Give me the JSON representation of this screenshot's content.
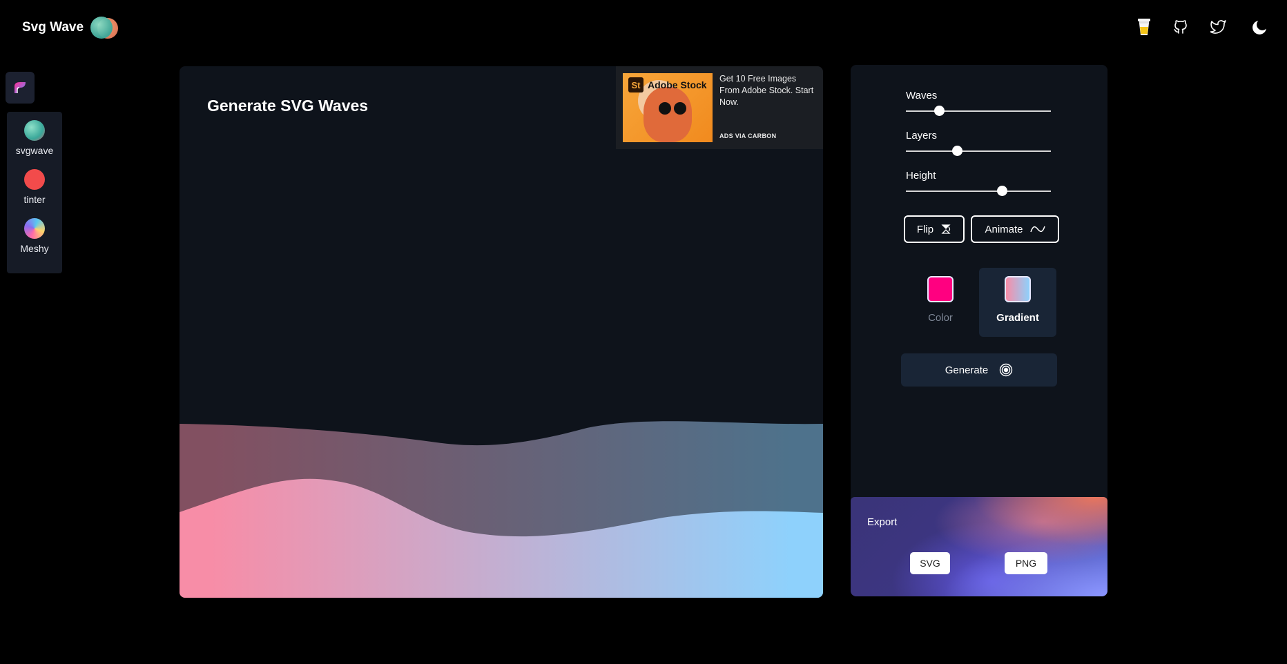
{
  "header": {
    "title": "Svg Wave",
    "icons": [
      "coffee-icon",
      "github-icon",
      "twitter-icon",
      "moon-icon"
    ]
  },
  "sidebar": {
    "apps": [
      {
        "label": "svgwave",
        "color": "#4cc9b0"
      },
      {
        "label": "tinter",
        "color": "#f24b4b"
      },
      {
        "label": "Meshy",
        "color": "#8a6cf0"
      }
    ]
  },
  "canvas": {
    "title": "Generate SVG Waves"
  },
  "ad": {
    "brand": "Adobe Stock",
    "badge": "St",
    "text": "Get 10 Free Images From Adobe Stock. Start Now.",
    "via": "ADS VIA CARBON"
  },
  "controls": {
    "sliders": [
      {
        "label": "Waves",
        "value": 0.23
      },
      {
        "label": "Layers",
        "value": 0.35
      },
      {
        "label": "Height",
        "value": 0.66
      }
    ],
    "flip_label": "Flip",
    "animate_label": "Animate",
    "color_label": "Color",
    "gradient_label": "Gradient",
    "color_value": "#ff0080",
    "gradient_colors": [
      "#f78da7",
      "#8ed1fc"
    ],
    "selected_mode": "Gradient",
    "generate_label": "Generate"
  },
  "export": {
    "title": "Export",
    "svg_label": "SVG",
    "png_label": "PNG"
  },
  "colors": {
    "background": "#000000",
    "panel": "#0e131b",
    "wave_start": "#f78da7",
    "wave_end": "#8ed1fc"
  }
}
